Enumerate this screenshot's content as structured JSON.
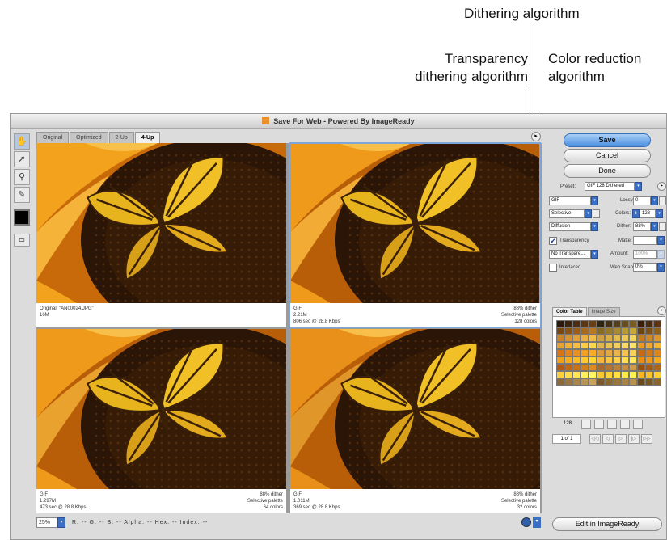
{
  "annotations": {
    "dithering": "Dithering algorithm",
    "transparency_line1": "Transparency",
    "transparency_line2": "dithering algorithm",
    "color_line1": "Color reduction",
    "color_line2": "algorithm"
  },
  "window": {
    "title": "Save For Web - Powered By ImageReady"
  },
  "tools": {
    "active": "hand-tool"
  },
  "tabs": [
    {
      "label": "Original",
      "active": false
    },
    {
      "label": "Optimized",
      "active": false
    },
    {
      "label": "2-Up",
      "active": false
    },
    {
      "label": "4-Up",
      "active": true
    }
  ],
  "panes": [
    {
      "left_line1": "Original: \"AN00024.JPG\"",
      "left_line2": "16M",
      "left_line3": "",
      "right_line1": "",
      "right_line2": "",
      "right_line3": "",
      "selected": false
    },
    {
      "left_line1": "GIF",
      "left_line2": "2.21M",
      "left_line3": "806 sec @ 28.8 Kbps",
      "right_line1": "88% dither",
      "right_line2": "Selective palette",
      "right_line3": "128 colors",
      "selected": true
    },
    {
      "left_line1": "GIF",
      "left_line2": "1.297M",
      "left_line3": "473 sec @ 28.8 Kbps",
      "right_line1": "88% dither",
      "right_line2": "Selective palette",
      "right_line3": "64 colors",
      "selected": false
    },
    {
      "left_line1": "GIF",
      "left_line2": "1.011M",
      "left_line3": "369 sec @ 28.8 Kbps",
      "right_line1": "88% dither",
      "right_line2": "Selective palette",
      "right_line3": "32 colors",
      "selected": false
    }
  ],
  "statusbar": {
    "zoom": "25%",
    "readout": "R: --  G: --  B: --  Alpha: --  Hex: --  Index: --"
  },
  "buttons": {
    "save": "Save",
    "cancel": "Cancel",
    "done": "Done",
    "edit": "Edit in ImageReady"
  },
  "settings": {
    "preset_label": "Preset:",
    "preset_value": "GIF 128 Dithered",
    "format_value": "GIF",
    "color_reduction_value": "Selective",
    "dither_algorithm_value": "Diffusion",
    "lossy_label": "Lossy:",
    "lossy_value": "0",
    "colors_label": "Colors:",
    "colors_value": "128",
    "dither_label": "Dither:",
    "dither_value": "88%",
    "transparency_label": "Transparency",
    "transparency_checked": true,
    "matte_label": "Matte:",
    "transparency_dither_value": "No Transpare...",
    "amount_label": "Amount:",
    "amount_value": "100%",
    "interlaced_label": "Interlaced",
    "interlaced_checked": false,
    "websnap_label": "Web Snap:",
    "websnap_value": "0%"
  },
  "color_table": {
    "tabs": [
      {
        "label": "Color Table",
        "active": true
      },
      {
        "label": "Image Size",
        "active": false
      }
    ],
    "count": "128",
    "swatches": [
      "#2b1a0c",
      "#3a2410",
      "#4a2d12",
      "#5a3615",
      "#6b3f16",
      "#2f2410",
      "#423016",
      "#55401c",
      "#6a4d1e",
      "#7a5a20",
      "#3b1f0a",
      "#4c2a0d",
      "#5e3510",
      "#7a4814",
      "#8a5418",
      "#9b5f1b",
      "#ab6b1e",
      "#bb7820",
      "#8a6a22",
      "#9a7a28",
      "#aa8a2e",
      "#ba9a32",
      "#c9a838",
      "#6d4512",
      "#7f5316",
      "#906119",
      "#c9842a",
      "#d49232",
      "#dea03a",
      "#e8ae42",
      "#f0bc4a",
      "#cfa040",
      "#d8ae48",
      "#e2bc50",
      "#eac858",
      "#f2d460",
      "#c47a1e",
      "#d08824",
      "#dc962a",
      "#e8a230",
      "#f0b036",
      "#f6be3c",
      "#fbcc44",
      "#fed84c",
      "#e0b44c",
      "#e8c254",
      "#f0ce5c",
      "#f6da64",
      "#fce46c",
      "#e89a26",
      "#f0a82c",
      "#f6b632",
      "#d87416",
      "#e2821a",
      "#ea901e",
      "#f29e22",
      "#f8ac28",
      "#d89a3a",
      "#e0a842",
      "#e8b64a",
      "#f0c452",
      "#f6d25a",
      "#c86a12",
      "#d27816",
      "#dc861a",
      "#f0a018",
      "#f4ae1e",
      "#f8bc24",
      "#fcca2a",
      "#ffd632",
      "#f6b83a",
      "#fac642",
      "#fdd24a",
      "#ffde52",
      "#ffe85a",
      "#e88c12",
      "#ee9a16",
      "#f4a81a",
      "#b85a0e",
      "#c26612",
      "#cc7216",
      "#d67e1a",
      "#e08a1e",
      "#a86a2a",
      "#b27632",
      "#bc823a",
      "#c68e42",
      "#d09a4a",
      "#9a4e0c",
      "#a45a10",
      "#ae6614",
      "#fcd040",
      "#ffdc48",
      "#ffe650",
      "#fff058",
      "#fff660",
      "#f8c830",
      "#fcd438",
      "#ffe040",
      "#ffea48",
      "#fff250",
      "#f6b822",
      "#fac42a",
      "#fdd032",
      "#8a6a3a",
      "#9a7842",
      "#aa864a",
      "#ba9452",
      "#caa25a",
      "#7a5a2a",
      "#8a6832",
      "#9a763a",
      "#aa8442",
      "#ba924a",
      "#6a4a1a",
      "#7a5822",
      "#8a662a",
      "#ffffff",
      "#ffffff",
      "#ffffff",
      "#ffffff",
      "#ffffff",
      "#ffffff",
      "#ffffff",
      "#ffffff",
      "#ffffff",
      "#ffffff",
      "#ffffff",
      "#ffffff",
      "#ffffff"
    ]
  },
  "pager": {
    "label": "1 of 1"
  }
}
